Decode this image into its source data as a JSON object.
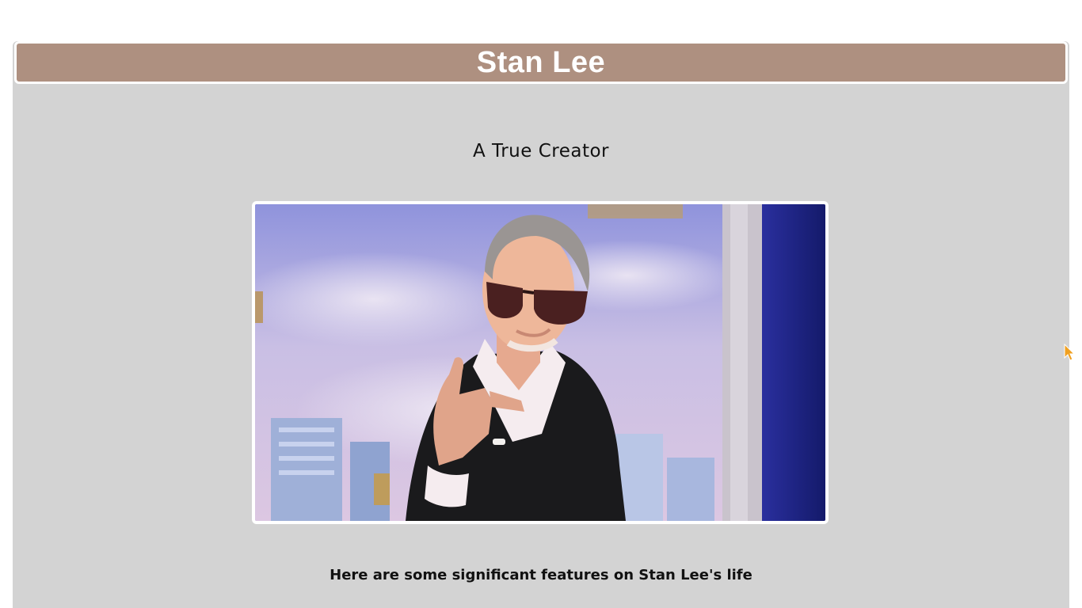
{
  "header": {
    "title": "Stan Lee",
    "bar_color": "#ae9080"
  },
  "main": {
    "subtitle": "A True Creator",
    "image": {
      "alt": "Stan Lee pointing at camera wearing sunglasses"
    },
    "caption": "Here are some significant features on Stan Lee's life"
  },
  "colors": {
    "page_background": "#d3d3d3",
    "frame": "#ffffff"
  },
  "icons": {
    "cursor": "mouse-pointer-icon"
  }
}
